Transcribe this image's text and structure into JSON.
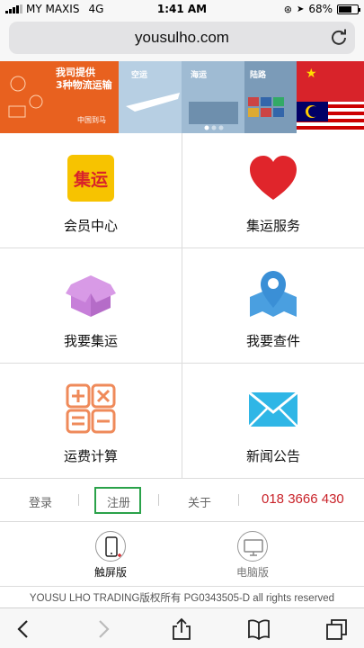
{
  "statusbar": {
    "carrier": "MY MAXIS",
    "network": "4G",
    "time": "1:41 AM",
    "battery": "68%"
  },
  "browser": {
    "url": "yousulho.com"
  },
  "banner": {
    "slogan_line1": "我司提供",
    "slogan_line2": "3种物流运输",
    "slogan_line3": "中国到马",
    "tag_air": "空运",
    "tag_sea": "海运",
    "tag_land": "陆路"
  },
  "grid": [
    {
      "label": "会员中心",
      "icon": "shipping-logo-icon"
    },
    {
      "label": "集运服务",
      "icon": "heart-icon"
    },
    {
      "label": "我要集运",
      "icon": "box-icon"
    },
    {
      "label": "我要查件",
      "icon": "location-pin-icon"
    },
    {
      "label": "运费计算",
      "icon": "calculator-icon"
    },
    {
      "label": "新闻公告",
      "icon": "envelope-icon"
    }
  ],
  "icon_text": {
    "logo_text": "集运"
  },
  "links": {
    "login": "登录",
    "register": "注册",
    "about": "关于",
    "phone": "018 3666 430"
  },
  "versions": {
    "touch": "触屏版",
    "pc": "电脑版"
  },
  "footer": {
    "copyright": "YOUSU LHO TRADING版权所有 PG0343505-D all rights reserved"
  },
  "colors": {
    "accent_red": "#c9232a",
    "register_border": "#2aa24a",
    "logo_yellow": "#f7c300",
    "heart_red": "#e0252b",
    "box_purple": "#c77fd9",
    "pin_blue": "#4a9fe0",
    "calc_orange": "#ef8a5a",
    "envelope_cyan": "#2fb6e6"
  }
}
